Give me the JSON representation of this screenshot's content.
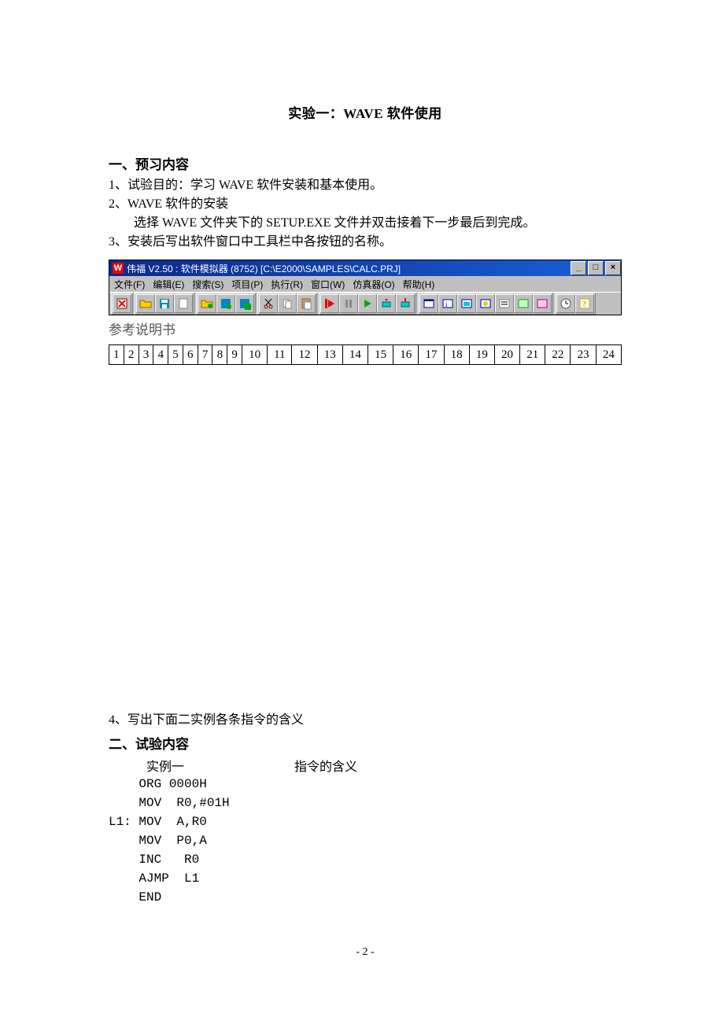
{
  "doc": {
    "title": "实验一：WAVE 软件使用",
    "sec1_head": "一、预习内容",
    "line1": "1、试验目的：学习 WAVE 软件安装和基本使用。",
    "line2": "2、WAVE 软件的安装",
    "line2b": "选择 WAVE 文件夹下的 SETUP.EXE 文件并双击接着下一步最后到完成。",
    "line3": "3、安装后写出软件窗口中工具栏中各按钮的名称。",
    "refnote": "参考说明书",
    "line4": "4、写出下面二实例各条指令的含义",
    "sec2_head": "二、试验内容",
    "ex1_label": "实例一",
    "ex1_meaning": "指令的含义",
    "code_lines": [
      "    ORG 0000H",
      "    MOV  R0,#01H",
      "L1: MOV  A,R0",
      "    MOV  P0,A",
      "    INC   R0",
      "    AJMP  L1",
      "    END"
    ],
    "page_no": "- 2 -"
  },
  "app": {
    "title_logo": "W",
    "title_text": "伟福 V2.50 : 软件模拟器 (8752) [C:\\E2000\\SAMPLES\\CALC.PRJ]",
    "min": "_",
    "max": "□",
    "close": "×",
    "menus": [
      "文件(F)",
      "编辑(E)",
      "搜索(S)",
      "项目(P)",
      "执行(R)",
      "窗口(W)",
      "仿真器(O)",
      "帮助(H)"
    ]
  },
  "numcells": [
    "1",
    "2",
    "3",
    "4",
    "5",
    "6",
    "7",
    "8",
    "9",
    "10",
    "11",
    "12",
    "13",
    "14",
    "15",
    "16",
    "17",
    "18",
    "19",
    "20",
    "21",
    "22",
    "23",
    "24"
  ],
  "icons": {
    "exit": "exit",
    "open": "open",
    "save": "save",
    "new": "new",
    "cut": "cut",
    "copy": "copy",
    "paste": "paste",
    "find": "find",
    "replace": "replace",
    "goto": "goto",
    "reset": "reset",
    "pause": "pause",
    "run": "run",
    "stepover": "stepover",
    "stepin": "stepin",
    "w1": "w1",
    "w2": "w2",
    "w3": "w3",
    "w4": "w4",
    "w5": "w5",
    "w6": "w6",
    "w7": "w7",
    "clock": "clock",
    "help": "help"
  }
}
